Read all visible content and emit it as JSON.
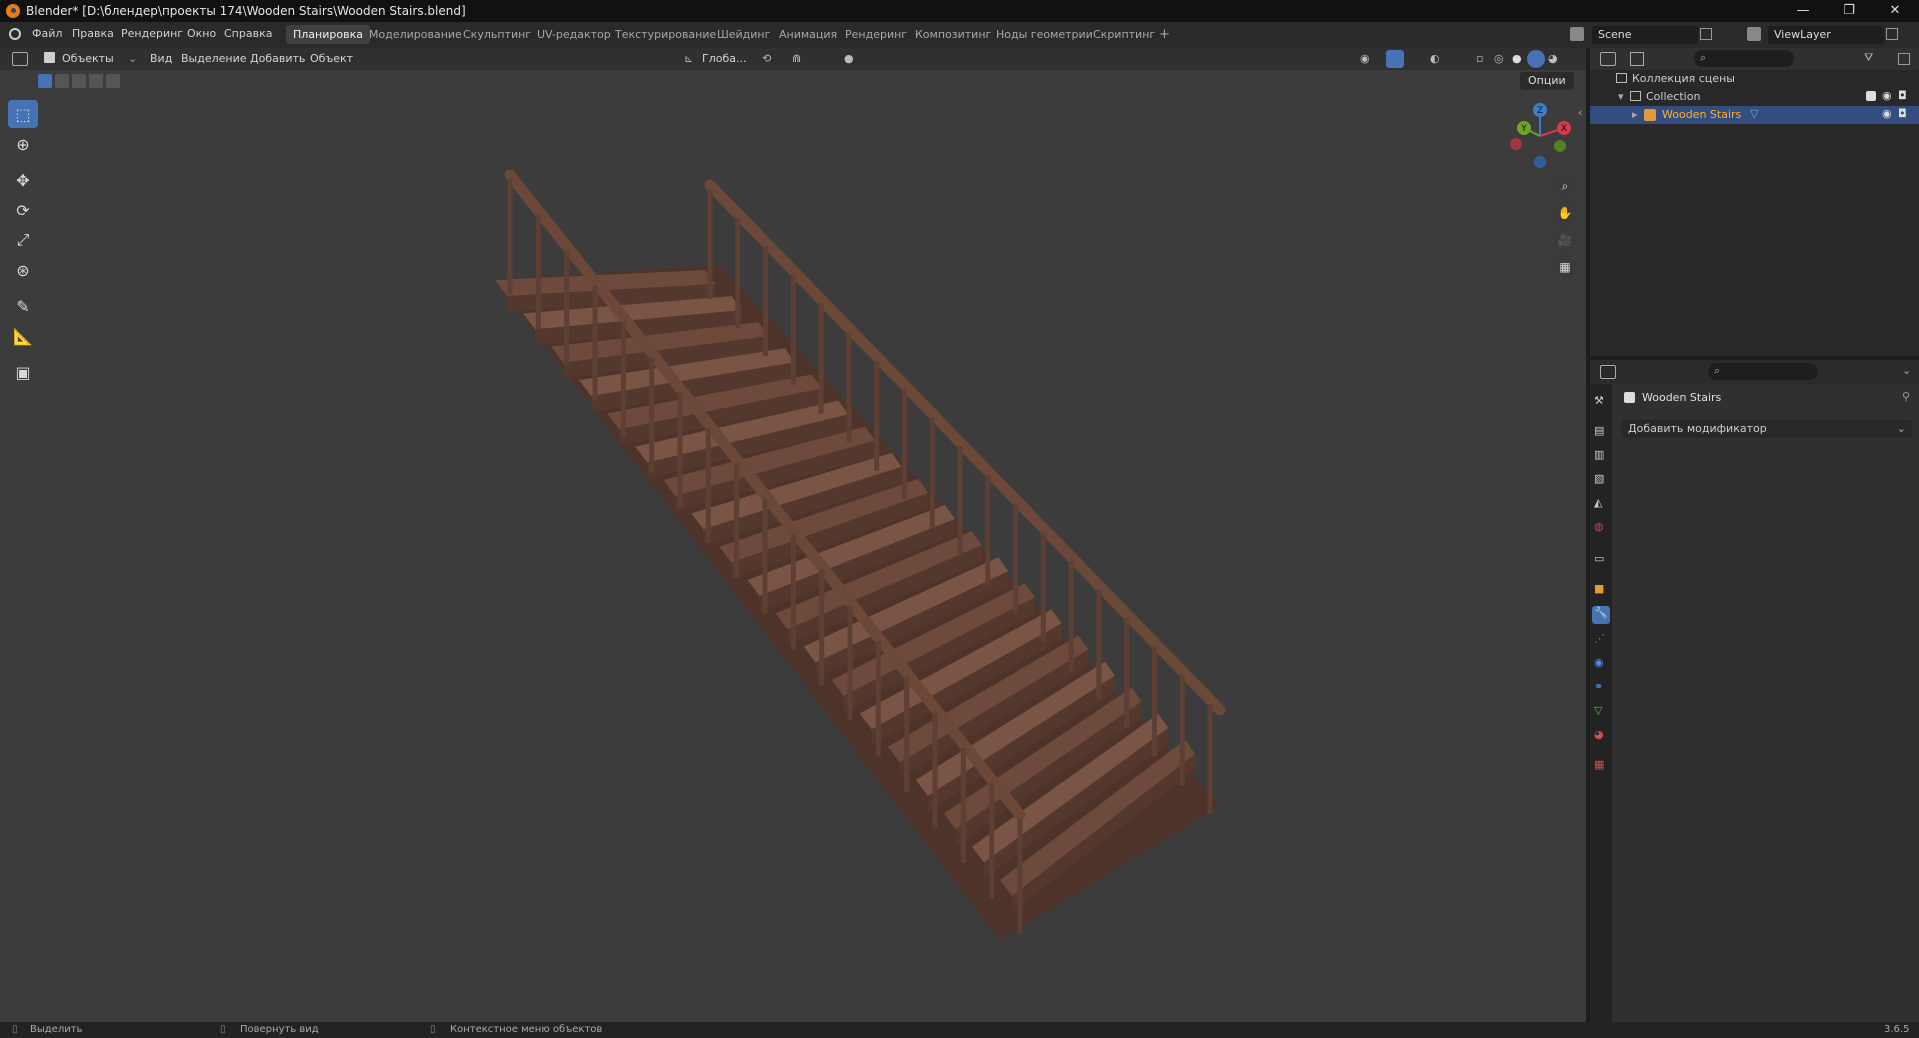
{
  "window": {
    "title": "Blender* [D:\\блендер\\проекты 174\\Wooden Stairs\\Wooden Stairs.blend]",
    "controls": [
      "—",
      "❐",
      "✕"
    ]
  },
  "menu": [
    "Файл",
    "Правка",
    "Рендеринг",
    "Окно",
    "Справка"
  ],
  "workspaces": [
    "Планировка",
    "Моделирование",
    "Скульптинг",
    "UV-редактор",
    "Текстурирование",
    "Шейдинг",
    "Анимация",
    "Рендеринг",
    "Композитинг",
    "Ноды геометрии",
    "Скриптинг"
  ],
  "workspace_add": "+",
  "scene": {
    "name": "Scene",
    "view_layer": "ViewLayer"
  },
  "viewport_header": {
    "mode": "Объекты",
    "menus": [
      "Вид",
      "Выделение",
      "Добавить",
      "Объект"
    ],
    "orientation": "Глоба...",
    "options": "Опции"
  },
  "gizmo": {
    "x": "X",
    "y": "Y",
    "z": "Z"
  },
  "outliner": {
    "root": "Коллекция сцены",
    "collection": "Collection",
    "object": "Wooden Stairs"
  },
  "properties": {
    "object_name": "Wooden Stairs",
    "add_modifier": "Добавить модификатор"
  },
  "status": {
    "select": "Выделить",
    "rotate": "Повернуть вид",
    "context": "Контекстное меню объектов",
    "version": "3.6.5"
  },
  "colors": {
    "accent": "#4772b3",
    "selected_text": "#ffaf29",
    "wood_light": "#7a5444",
    "wood_dark": "#4e3329",
    "axis_x": "#d9394a",
    "axis_y": "#6ea524",
    "axis_z": "#3d7dce"
  }
}
